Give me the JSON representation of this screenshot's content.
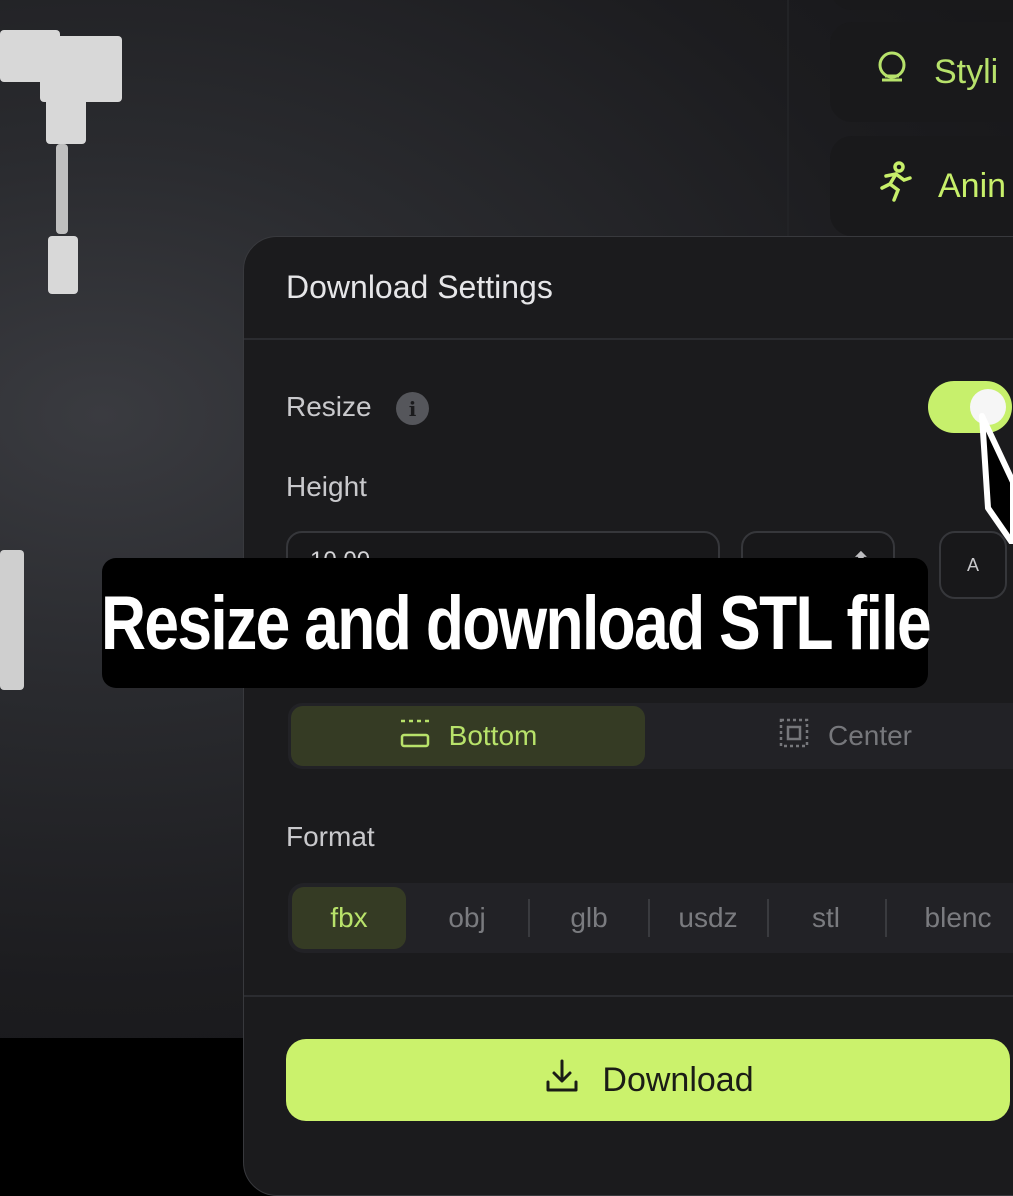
{
  "side_buttons": [
    {
      "label": "Styli",
      "icon": "stylize-icon"
    },
    {
      "label": "Anin",
      "icon": "running-person-icon"
    }
  ],
  "panel": {
    "title": "Download Settings",
    "resize_label": "Resize",
    "resize_on": true,
    "height_label": "Height",
    "height_value": "10.00",
    "auto_label": "A",
    "origin_options": [
      {
        "label": "Bottom",
        "selected": true
      },
      {
        "label": "Center",
        "selected": false
      }
    ],
    "format_label": "Format",
    "formats": [
      "fbx",
      "obj",
      "glb",
      "usdz",
      "stl",
      "blenc"
    ],
    "selected_format": "fbx",
    "download_label": "Download"
  },
  "caption": "Resize and download STL file",
  "colors": {
    "accent": "#cbf26c",
    "accent_text": "#b8e26a",
    "panel_bg": "#1b1b1d"
  }
}
